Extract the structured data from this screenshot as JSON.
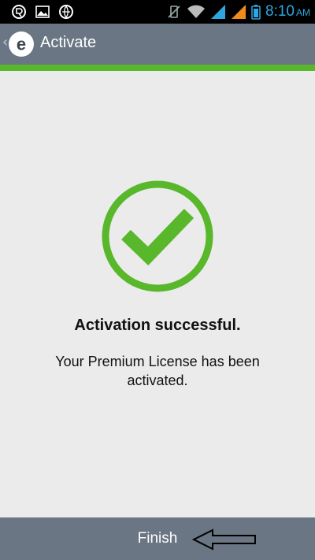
{
  "status_bar": {
    "time": "8:10",
    "ampm": "AM",
    "icons": [
      "notification-icon",
      "gallery-icon",
      "browser-icon",
      "vibrate-icon",
      "wifi-icon",
      "signal-icon",
      "signal-icon-2",
      "battery-icon"
    ]
  },
  "action_bar": {
    "back_glyph": "‹",
    "title": "Activate",
    "logo_letter": "e"
  },
  "main": {
    "heading": "Activation successful.",
    "message": "Your Premium License has been activated."
  },
  "bottom_bar": {
    "finish_label": "Finish"
  },
  "colors": {
    "accent_green": "#58b72a",
    "bar_gray": "#6a7683",
    "background": "#ebebeb",
    "clock_blue": "#2fa6e0"
  }
}
